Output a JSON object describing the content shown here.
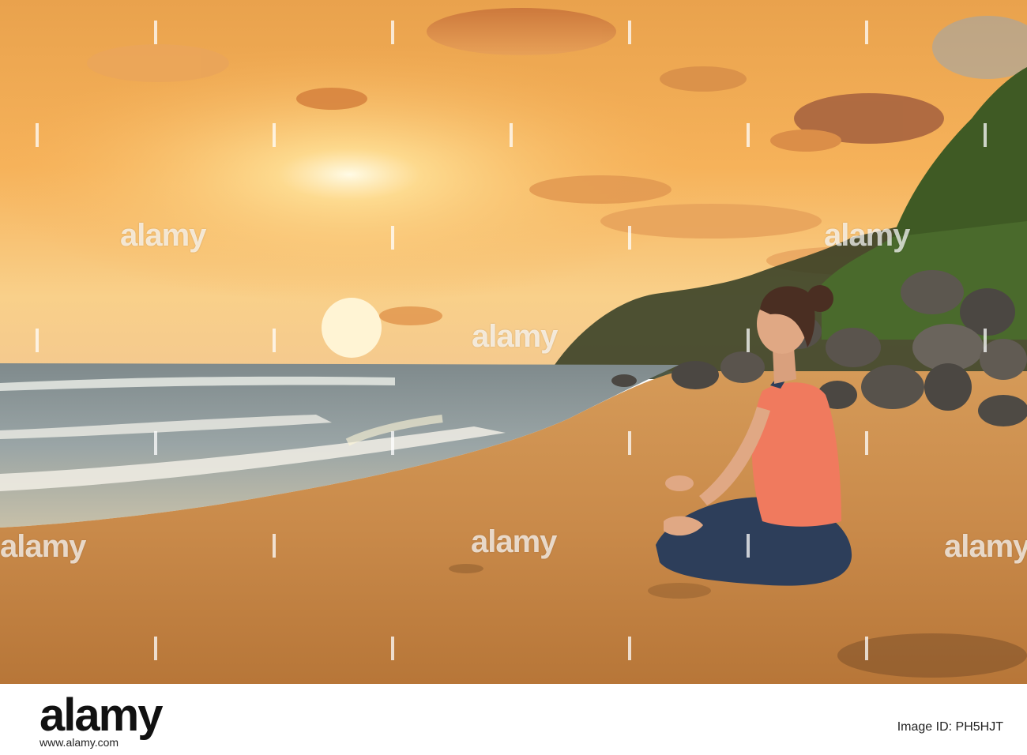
{
  "watermark": {
    "text": "alamy"
  },
  "footer": {
    "logo": "alamy",
    "image_id": "Image ID: PH5HJT",
    "url": "www.alamy.com"
  },
  "colors": {
    "sky_top": "#f0a64a",
    "sun": "#fff3c4",
    "sand": "#c98a4a",
    "tank_top": "#f07a5e",
    "pants": "#2d3e5a"
  }
}
